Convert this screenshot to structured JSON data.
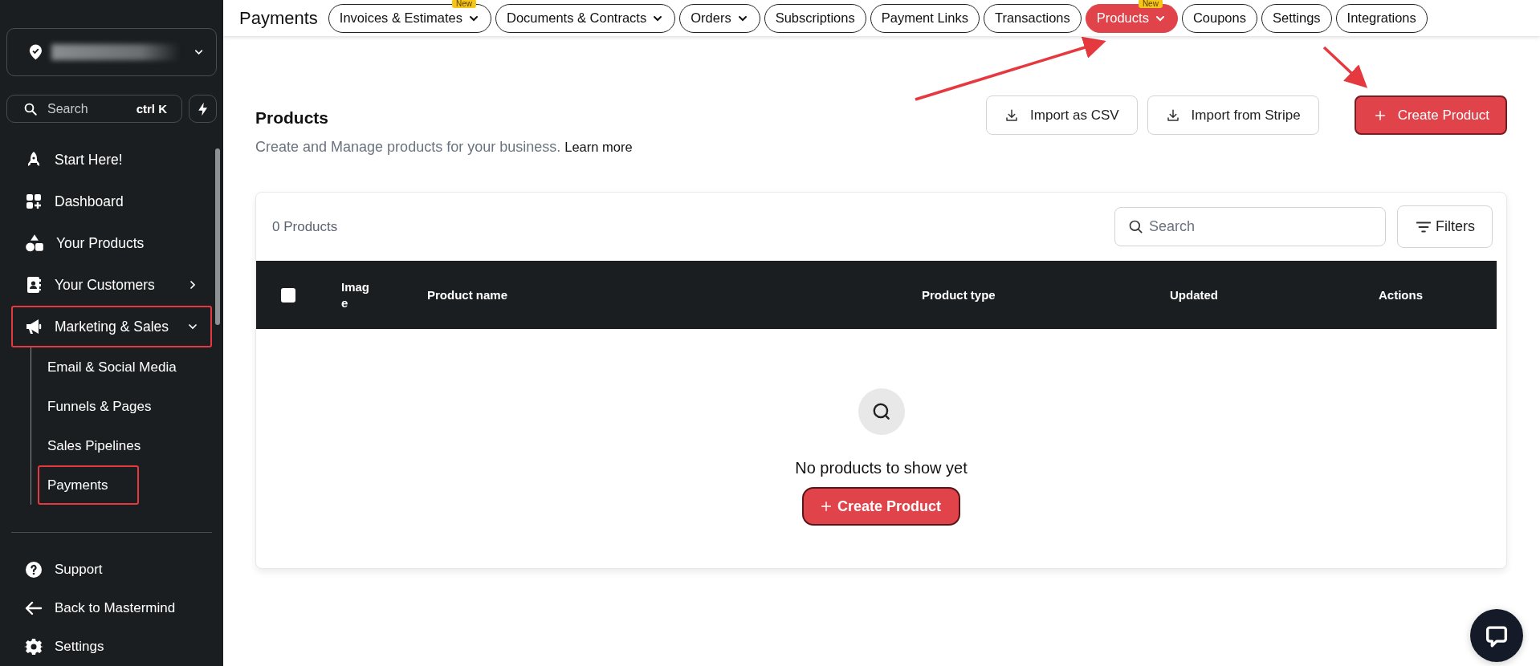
{
  "sidebar": {
    "account": {
      "expanded": false
    },
    "search": {
      "placeholder": "Search",
      "shortcut": "ctrl K"
    },
    "items": [
      {
        "label": "Start Here!",
        "highlighted": false
      },
      {
        "label": "Dashboard",
        "highlighted": false
      },
      {
        "label": "Your Products",
        "highlighted": false
      },
      {
        "label": "Your Customers",
        "highlighted": false,
        "expanded": false
      },
      {
        "label": "Marketing & Sales",
        "highlighted": true,
        "expanded": true,
        "children": [
          {
            "label": "Email & Social Media",
            "highlighted": false
          },
          {
            "label": "Funnels & Pages",
            "highlighted": false
          },
          {
            "label": "Sales Pipelines",
            "highlighted": false
          },
          {
            "label": "Payments",
            "highlighted": true
          }
        ]
      }
    ],
    "footer": [
      {
        "label": "Support"
      },
      {
        "label": "Back to Mastermind"
      },
      {
        "label": "Settings"
      }
    ]
  },
  "topbar": {
    "title": "Payments",
    "tabs": [
      {
        "label": "Invoices & Estimates",
        "selected": false,
        "dropdown": true,
        "badge": "New"
      },
      {
        "label": "Documents & Contracts",
        "selected": false,
        "dropdown": true
      },
      {
        "label": "Orders",
        "selected": false,
        "dropdown": true
      },
      {
        "label": "Subscriptions",
        "selected": false,
        "dropdown": false
      },
      {
        "label": "Payment Links",
        "selected": false,
        "dropdown": false
      },
      {
        "label": "Transactions",
        "selected": false,
        "dropdown": false
      },
      {
        "label": "Products",
        "selected": true,
        "dropdown": true,
        "badge": "New"
      },
      {
        "label": "Coupons",
        "selected": false,
        "dropdown": false
      },
      {
        "label": "Settings",
        "selected": false,
        "dropdown": false
      },
      {
        "label": "Integrations",
        "selected": false,
        "dropdown": false
      }
    ]
  },
  "page": {
    "title": "Products",
    "subtitle": "Create and Manage products for your business.",
    "learn_more": "Learn more",
    "actions": [
      {
        "label": "Import as CSV",
        "kind": "import"
      },
      {
        "label": "Import from Stripe",
        "kind": "import"
      },
      {
        "label": "Create Product",
        "kind": "create"
      }
    ]
  },
  "table": {
    "count": "0 Products",
    "search": {
      "placeholder": "Search"
    },
    "filters": "Filters",
    "select_all": {
      "checked": false
    },
    "columns": [
      "Image",
      "Product name",
      "Product type",
      "Updated",
      "Actions"
    ],
    "empty": {
      "message": "No products to show yet",
      "button": "Create Product"
    }
  }
}
